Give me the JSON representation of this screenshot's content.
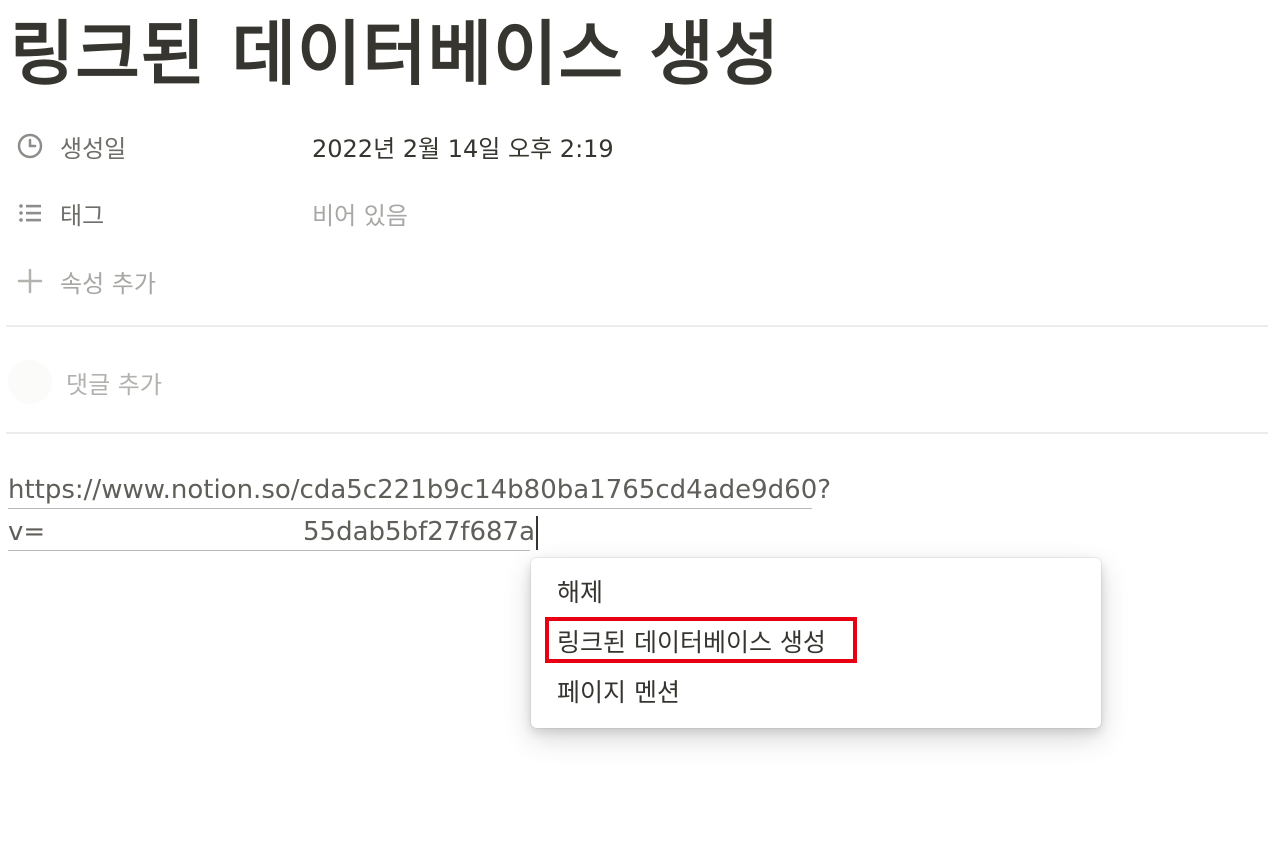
{
  "page": {
    "title": "링크된 데이터베이스 생성"
  },
  "properties": [
    {
      "icon": "clock-icon",
      "label": "생성일",
      "value": "2022년 2월 14일 오후 2:19",
      "empty": false
    },
    {
      "icon": "list-icon",
      "label": "태그",
      "value": "비어 있음",
      "empty": true
    }
  ],
  "add_property": {
    "icon": "plus-icon",
    "label": "속성 추가"
  },
  "comment": {
    "placeholder": "댓글 추가"
  },
  "url": {
    "line1": "https://www.notion.so/cda5c221b9c14b80ba1765cd4ade9d60?",
    "line2_prefix": "v=",
    "line2_suffix": "55dab5bf27f687a"
  },
  "context_menu": {
    "items": [
      {
        "label": "해제"
      },
      {
        "label": "링크된 데이터베이스 생성",
        "highlighted": true
      },
      {
        "label": "페이지 멘션"
      }
    ],
    "highlight_color": "#e60012"
  }
}
